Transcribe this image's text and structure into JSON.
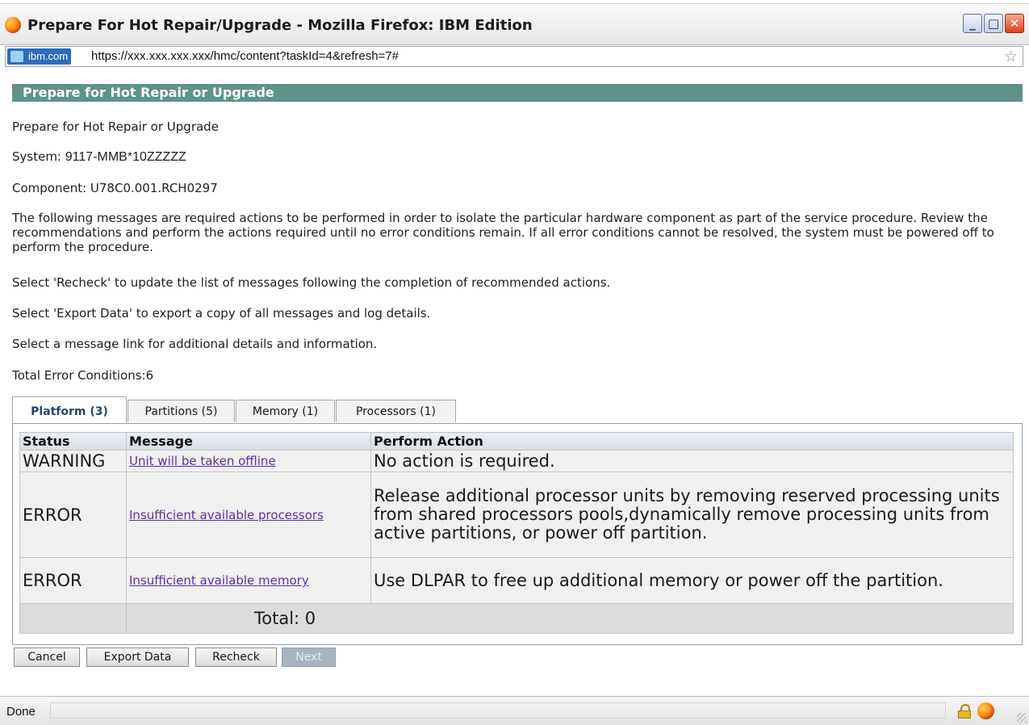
{
  "window": {
    "title": "Prepare For Hot Repair/Upgrade - Mozilla Firefox: IBM Edition",
    "controls": {
      "minimize": "_",
      "maximize": "□",
      "close": "✕"
    }
  },
  "urlbar": {
    "site_badge": "ibm.com",
    "url": "https://xxx.xxx.xxx.xxx/hmc/content?taskId=4&refresh=7#"
  },
  "page": {
    "header": "Prepare for Hot Repair or Upgrade",
    "heading_text": "Prepare for Hot Repair or Upgrade",
    "system_label": "System:",
    "system_value": "9117-MMB*10ZZZZZ",
    "component": "Component: U78C0.001.RCH0297",
    "description": "The following messages are required actions to be performed in order to isolate the particular hardware component as part of the service procedure. Review the recommendations and perform the actions required until no error conditions remain. If all error conditions cannot be resolved, the system must be powered off to perform the procedure.",
    "recheck_instruction": "Select 'Recheck' to update the list of messages following the completion of recommended actions.",
    "export_instruction": "Select 'Export Data' to export a copy of all messages and log details.",
    "link_instruction": "Select a message link for additional details and information.",
    "total_errors": "Total Error Conditions:6"
  },
  "tabs": [
    {
      "label": "Platform (3)",
      "active": true
    },
    {
      "label": "Partitions (5)",
      "active": false
    },
    {
      "label": "Memory (1)",
      "active": false
    },
    {
      "label": "Processors (1)",
      "active": false
    }
  ],
  "table": {
    "headers": [
      "Status",
      "Message",
      "Perform Action"
    ],
    "rows": [
      {
        "status": "WARNING",
        "message": "Unit will be taken offline",
        "action": "No action is required."
      },
      {
        "status": "ERROR",
        "message": "Insufficient available processors",
        "action": "Release additional processor units by removing reserved processing units from shared processors pools,dynamically remove processing units from active partitions, or power off partition."
      },
      {
        "status": "ERROR",
        "message": "Insufficient available memory",
        "action": "Use DLPAR to free up additional memory or power off the partition."
      }
    ],
    "total": "Total: 0"
  },
  "buttons": {
    "cancel": "Cancel",
    "export": "Export Data",
    "recheck": "Recheck",
    "next": "Next"
  },
  "statusbar": {
    "text": "Done"
  },
  "colors": {
    "header_bar": "#5f9289",
    "link": "#5c2fa5",
    "active_tab_text": "#24456e"
  }
}
